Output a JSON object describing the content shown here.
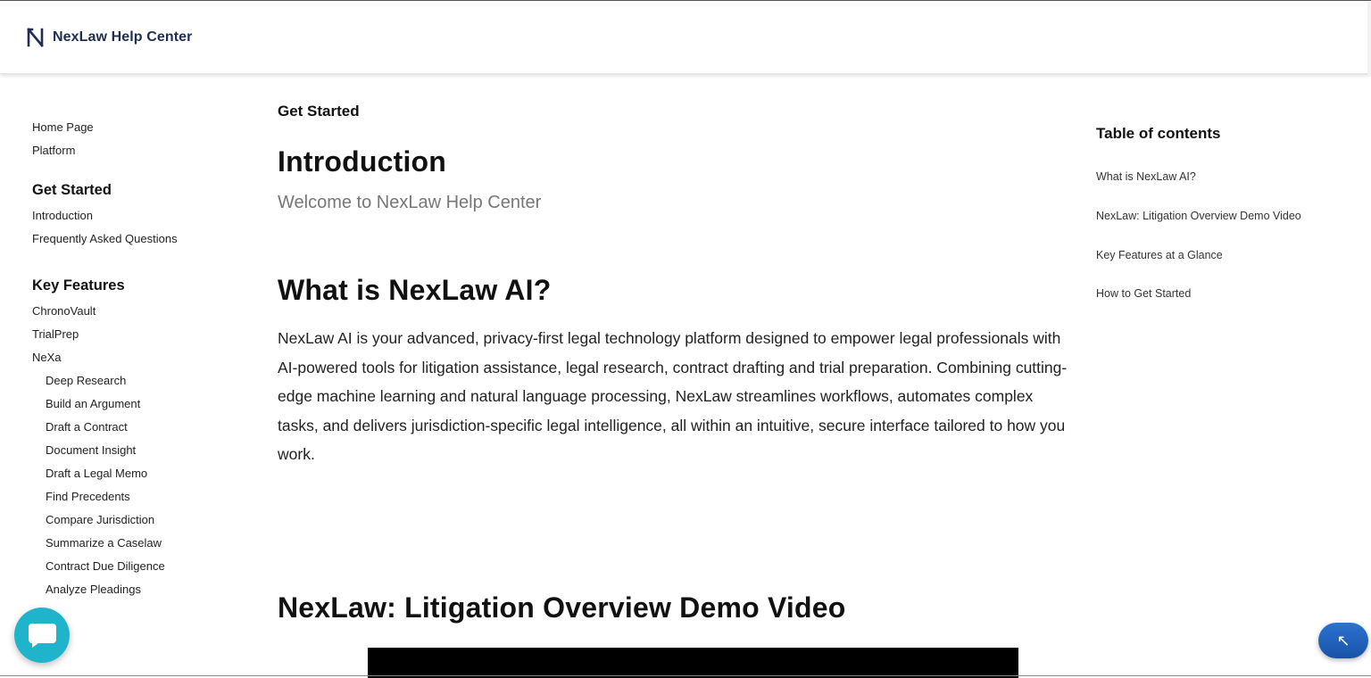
{
  "header": {
    "brand_name": "NexLaw Help Center",
    "logo_icon": "nexlaw-n-logo-icon"
  },
  "sidebar": {
    "top_links": [
      "Home Page",
      "Platform"
    ],
    "get_started": {
      "heading": "Get Started",
      "items": [
        "Introduction",
        "Frequently Asked Questions"
      ]
    },
    "key_features": {
      "heading": "Key Features",
      "items": [
        "ChronoVault",
        "TrialPrep",
        "NeXa"
      ],
      "nexa_items": [
        "Deep Research",
        "Build an Argument",
        "Draft a Contract",
        "Document Insight",
        "Draft a Legal Memo",
        "Find Precedents",
        "Compare Jurisdiction",
        "Summarize a Caselaw",
        "Contract Due Diligence",
        "Analyze Pleadings"
      ]
    }
  },
  "main": {
    "breadcrumb": "Get Started",
    "title": "Introduction",
    "subtitle": "Welcome to NexLaw Help Center",
    "section1": {
      "heading": "What is NexLaw AI?",
      "paragraph": "NexLaw AI is your advanced, privacy-first legal technology platform designed to empower legal professionals with AI-powered tools for litigation assistance, legal research, contract drafting and trial preparation. Combining cutting-edge machine learning and natural language processing, NexLaw streamlines workflows, automates complex tasks, and delivers jurisdiction-specific legal intelligence, all within an intuitive, secure interface tailored to how you work."
    },
    "section2": {
      "heading": "NexLaw: Litigation Overview Demo Video"
    }
  },
  "toc": {
    "title": "Table of contents",
    "items": [
      "What is NexLaw AI?",
      "NexLaw: Litigation Overview Demo Video",
      "Key Features at a Glance",
      "How to Get Started"
    ]
  },
  "widgets": {
    "chat_icon": "chat-bubble-icon",
    "scroll_top_icon": "arrow-up-left-icon",
    "chat_color": "#1fb4cc",
    "scroll_top_color": "#1f5fba"
  }
}
